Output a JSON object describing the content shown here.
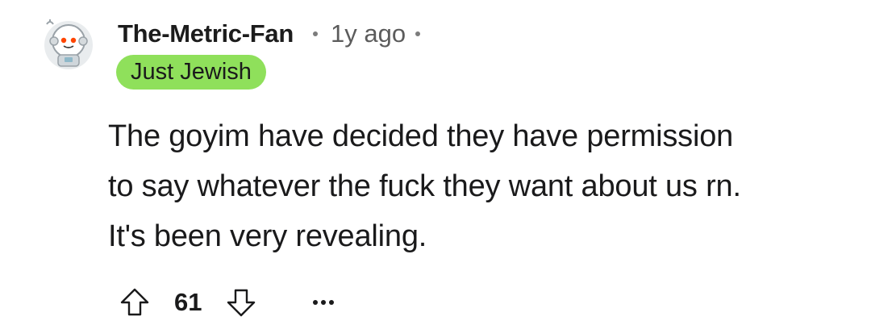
{
  "comment": {
    "author": {
      "username": "The-Metric-Fan",
      "avatar_icon": "snoo-astronaut-avatar-icon"
    },
    "timestamp": "1y ago",
    "flair": {
      "text": "Just Jewish",
      "color": "#8fe05b"
    },
    "body_lines": [
      "The goyim have decided they have permission",
      "to say whatever the fuck they want about us rn.",
      "It's been very revealing."
    ],
    "score": "61",
    "icons": {
      "upvote": "upvote-arrow-icon",
      "downvote": "downvote-arrow-icon",
      "more": "more-options-icon"
    }
  }
}
